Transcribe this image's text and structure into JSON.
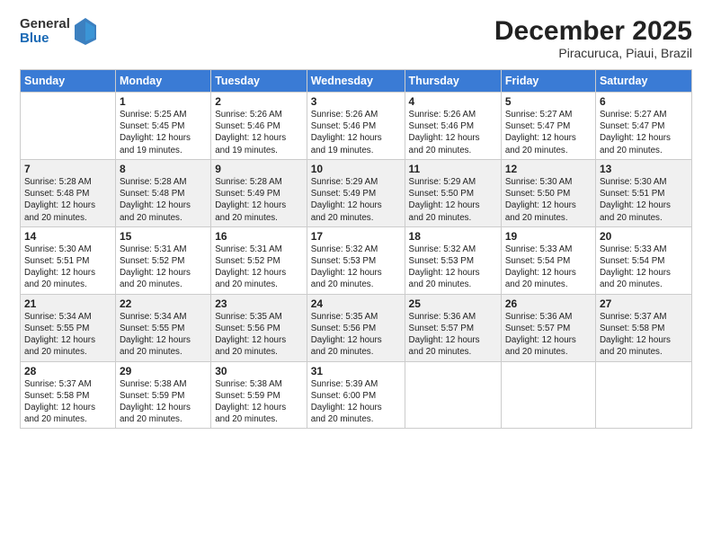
{
  "logo": {
    "general": "General",
    "blue": "Blue"
  },
  "header": {
    "month": "December 2025",
    "location": "Piracuruca, Piaui, Brazil"
  },
  "weekdays": [
    "Sunday",
    "Monday",
    "Tuesday",
    "Wednesday",
    "Thursday",
    "Friday",
    "Saturday"
  ],
  "weeks": [
    [
      {
        "day": "",
        "info": ""
      },
      {
        "day": "1",
        "info": "Sunrise: 5:25 AM\nSunset: 5:45 PM\nDaylight: 12 hours\nand 19 minutes."
      },
      {
        "day": "2",
        "info": "Sunrise: 5:26 AM\nSunset: 5:46 PM\nDaylight: 12 hours\nand 19 minutes."
      },
      {
        "day": "3",
        "info": "Sunrise: 5:26 AM\nSunset: 5:46 PM\nDaylight: 12 hours\nand 19 minutes."
      },
      {
        "day": "4",
        "info": "Sunrise: 5:26 AM\nSunset: 5:46 PM\nDaylight: 12 hours\nand 20 minutes."
      },
      {
        "day": "5",
        "info": "Sunrise: 5:27 AM\nSunset: 5:47 PM\nDaylight: 12 hours\nand 20 minutes."
      },
      {
        "day": "6",
        "info": "Sunrise: 5:27 AM\nSunset: 5:47 PM\nDaylight: 12 hours\nand 20 minutes."
      }
    ],
    [
      {
        "day": "7",
        "info": "Sunrise: 5:28 AM\nSunset: 5:48 PM\nDaylight: 12 hours\nand 20 minutes."
      },
      {
        "day": "8",
        "info": "Sunrise: 5:28 AM\nSunset: 5:48 PM\nDaylight: 12 hours\nand 20 minutes."
      },
      {
        "day": "9",
        "info": "Sunrise: 5:28 AM\nSunset: 5:49 PM\nDaylight: 12 hours\nand 20 minutes."
      },
      {
        "day": "10",
        "info": "Sunrise: 5:29 AM\nSunset: 5:49 PM\nDaylight: 12 hours\nand 20 minutes."
      },
      {
        "day": "11",
        "info": "Sunrise: 5:29 AM\nSunset: 5:50 PM\nDaylight: 12 hours\nand 20 minutes."
      },
      {
        "day": "12",
        "info": "Sunrise: 5:30 AM\nSunset: 5:50 PM\nDaylight: 12 hours\nand 20 minutes."
      },
      {
        "day": "13",
        "info": "Sunrise: 5:30 AM\nSunset: 5:51 PM\nDaylight: 12 hours\nand 20 minutes."
      }
    ],
    [
      {
        "day": "14",
        "info": "Sunrise: 5:30 AM\nSunset: 5:51 PM\nDaylight: 12 hours\nand 20 minutes."
      },
      {
        "day": "15",
        "info": "Sunrise: 5:31 AM\nSunset: 5:52 PM\nDaylight: 12 hours\nand 20 minutes."
      },
      {
        "day": "16",
        "info": "Sunrise: 5:31 AM\nSunset: 5:52 PM\nDaylight: 12 hours\nand 20 minutes."
      },
      {
        "day": "17",
        "info": "Sunrise: 5:32 AM\nSunset: 5:53 PM\nDaylight: 12 hours\nand 20 minutes."
      },
      {
        "day": "18",
        "info": "Sunrise: 5:32 AM\nSunset: 5:53 PM\nDaylight: 12 hours\nand 20 minutes."
      },
      {
        "day": "19",
        "info": "Sunrise: 5:33 AM\nSunset: 5:54 PM\nDaylight: 12 hours\nand 20 minutes."
      },
      {
        "day": "20",
        "info": "Sunrise: 5:33 AM\nSunset: 5:54 PM\nDaylight: 12 hours\nand 20 minutes."
      }
    ],
    [
      {
        "day": "21",
        "info": "Sunrise: 5:34 AM\nSunset: 5:55 PM\nDaylight: 12 hours\nand 20 minutes."
      },
      {
        "day": "22",
        "info": "Sunrise: 5:34 AM\nSunset: 5:55 PM\nDaylight: 12 hours\nand 20 minutes."
      },
      {
        "day": "23",
        "info": "Sunrise: 5:35 AM\nSunset: 5:56 PM\nDaylight: 12 hours\nand 20 minutes."
      },
      {
        "day": "24",
        "info": "Sunrise: 5:35 AM\nSunset: 5:56 PM\nDaylight: 12 hours\nand 20 minutes."
      },
      {
        "day": "25",
        "info": "Sunrise: 5:36 AM\nSunset: 5:57 PM\nDaylight: 12 hours\nand 20 minutes."
      },
      {
        "day": "26",
        "info": "Sunrise: 5:36 AM\nSunset: 5:57 PM\nDaylight: 12 hours\nand 20 minutes."
      },
      {
        "day": "27",
        "info": "Sunrise: 5:37 AM\nSunset: 5:58 PM\nDaylight: 12 hours\nand 20 minutes."
      }
    ],
    [
      {
        "day": "28",
        "info": "Sunrise: 5:37 AM\nSunset: 5:58 PM\nDaylight: 12 hours\nand 20 minutes."
      },
      {
        "day": "29",
        "info": "Sunrise: 5:38 AM\nSunset: 5:59 PM\nDaylight: 12 hours\nand 20 minutes."
      },
      {
        "day": "30",
        "info": "Sunrise: 5:38 AM\nSunset: 5:59 PM\nDaylight: 12 hours\nand 20 minutes."
      },
      {
        "day": "31",
        "info": "Sunrise: 5:39 AM\nSunset: 6:00 PM\nDaylight: 12 hours\nand 20 minutes."
      },
      {
        "day": "",
        "info": ""
      },
      {
        "day": "",
        "info": ""
      },
      {
        "day": "",
        "info": ""
      }
    ]
  ]
}
